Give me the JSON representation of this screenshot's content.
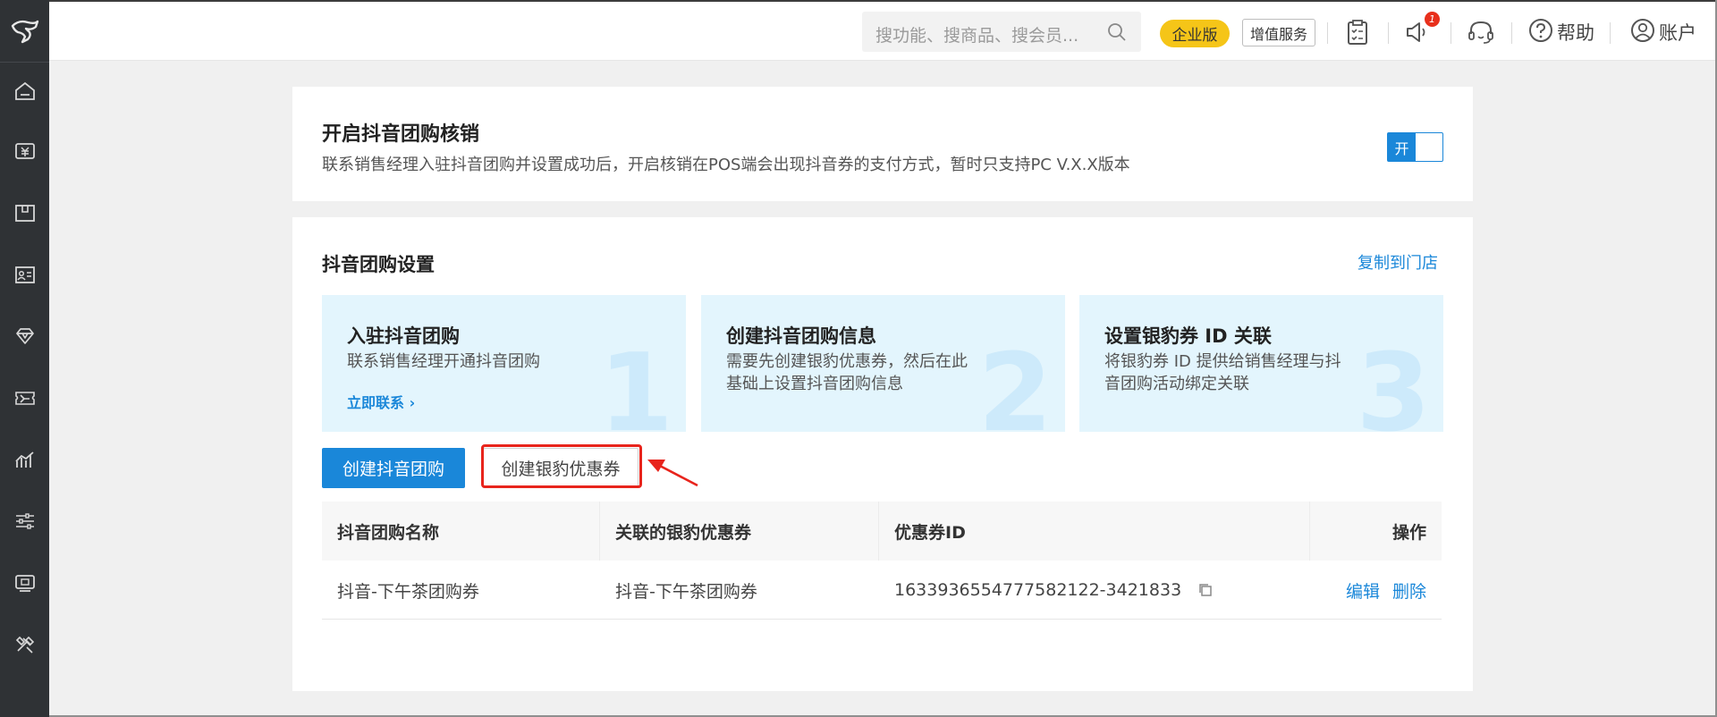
{
  "header": {
    "search_placeholder": "搜功能、搜商品、搜会员...",
    "edition_badge": "企业版",
    "value_added_label": "增值服务",
    "notification_count": "1",
    "help_label": "帮助",
    "account_label": "账户"
  },
  "sidebar": {
    "items": [
      {
        "icon": "home-icon"
      },
      {
        "icon": "currency-icon"
      },
      {
        "icon": "product-box-icon"
      },
      {
        "icon": "member-card-icon"
      },
      {
        "icon": "diamond-icon"
      },
      {
        "icon": "coupon-icon"
      },
      {
        "icon": "chart-icon"
      },
      {
        "icon": "settings-sliders-icon"
      },
      {
        "icon": "device-icon"
      },
      {
        "icon": "tools-icon"
      }
    ]
  },
  "verification": {
    "title": "开启抖音团购核销",
    "description": "联系销售经理入驻抖音团购并设置成功后，开启核销在POS端会出现抖音券的支付方式，暂时只支持PC V.X.X版本",
    "toggle_label": "开",
    "enabled": true
  },
  "settings": {
    "title": "抖音团购设置",
    "copy_link": "复制到门店",
    "steps": [
      {
        "title": "入驻抖音团购",
        "desc_lines": [
          "联系销售经理开通抖音团购"
        ],
        "link": "立即联系",
        "num": "1"
      },
      {
        "title": "创建抖音团购信息",
        "desc_lines": [
          "需要先创建银豹优惠券，然后在此",
          "基础上设置抖音团购信息"
        ],
        "num": "2"
      },
      {
        "title": "设置银豹券 ID 关联",
        "desc_lines": [
          "将银豹券 ID 提供给销售经理与抖",
          "音团购活动绑定关联"
        ],
        "num": "3"
      }
    ],
    "buttons": {
      "create_group": "创建抖音团购",
      "create_coupon": "创建银豹优惠券"
    },
    "table": {
      "headers": [
        "抖音团购名称",
        "关联的银豹优惠券",
        "优惠券ID",
        "操作"
      ],
      "rows": [
        {
          "name": "抖音-下午茶团购券",
          "coupon": "抖音-下午茶团购券",
          "coupon_id": "1633936554777582122-3421833",
          "edit": "编辑",
          "delete": "删除"
        }
      ]
    }
  },
  "colors": {
    "accent": "#1a87d9",
    "sidebar": "#2f3235",
    "highlight": "#e8241c",
    "edition": "#f5c518",
    "step_bg": "#e3f5fd"
  }
}
